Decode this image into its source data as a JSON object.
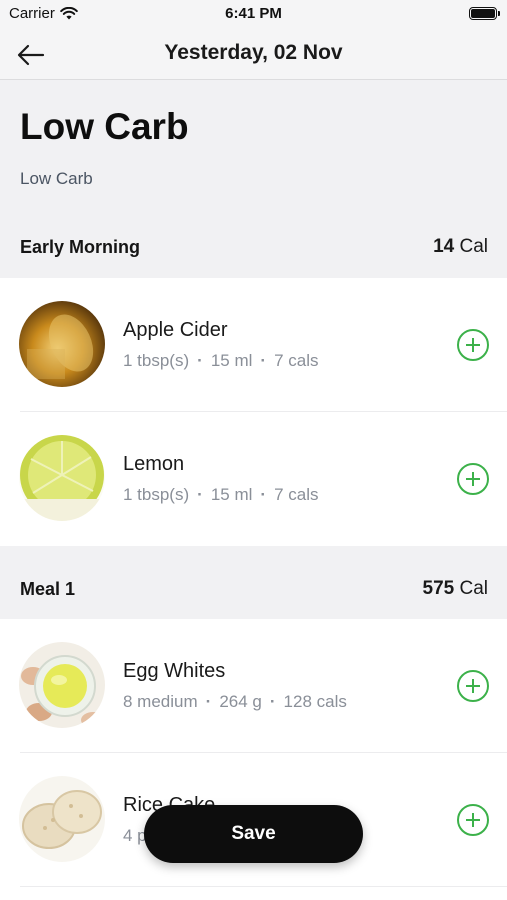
{
  "status_bar": {
    "carrier": "Carrier",
    "time": "6:41 PM"
  },
  "nav": {
    "title": "Yesterday, 02 Nov"
  },
  "plan": {
    "title": "Low Carb",
    "subtitle": "Low Carb"
  },
  "sections": [
    {
      "name": "Early Morning",
      "calories": "14",
      "cal_unit": "Cal",
      "items": [
        {
          "name": "Apple Cider",
          "quantity": "1 tbsp(s)",
          "amount": "15 ml",
          "cals": "7 cals",
          "icon": "apple-cider-photo"
        },
        {
          "name": "Lemon",
          "quantity": "1 tbsp(s)",
          "amount": "15 ml",
          "cals": "7 cals",
          "icon": "lemon-photo"
        }
      ]
    },
    {
      "name": "Meal 1",
      "calories": "575",
      "cal_unit": "Cal",
      "items": [
        {
          "name": "Egg Whites",
          "quantity": "8 medium",
          "amount": "264 g",
          "cals": "128 cals",
          "icon": "egg-whites-photo"
        },
        {
          "name": "Rice Cake",
          "quantity": "4 p",
          "amount": "",
          "cals": "",
          "icon": "rice-cake-photo"
        }
      ]
    }
  ],
  "save_label": "Save",
  "colors": {
    "accent": "#3cb14a",
    "section_bg": "#f1f1f3",
    "button_bg": "#0d0d0d"
  }
}
